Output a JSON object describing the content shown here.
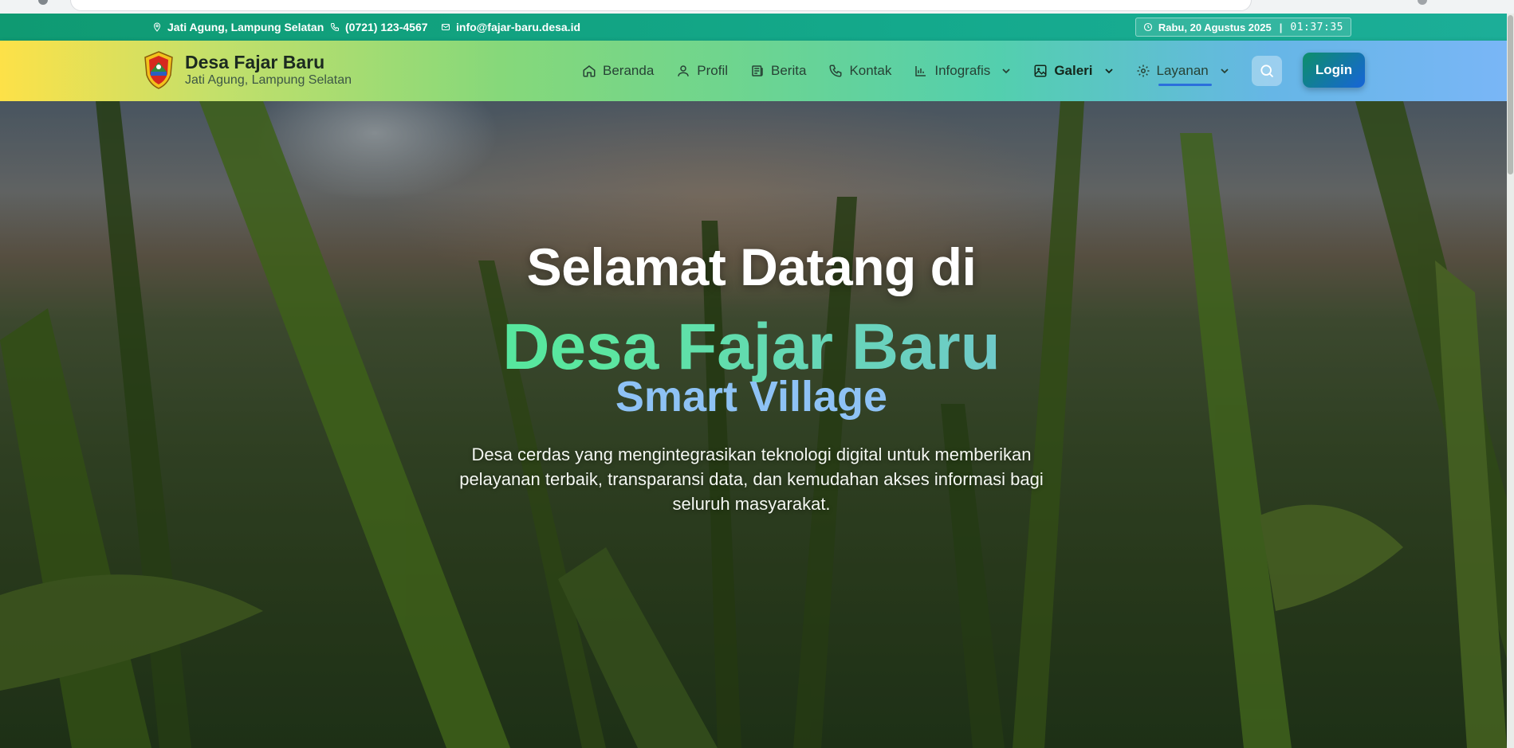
{
  "topbar": {
    "location": "Jati Agung, Lampung Selatan",
    "phone": "(0721) 123-4567",
    "email": "info@fajar-baru.desa.id",
    "date": "Rabu, 20 Agustus 2025",
    "time": "01:37:35"
  },
  "brand": {
    "title": "Desa Fajar Baru",
    "subtitle": "Jati Agung, Lampung Selatan"
  },
  "nav": {
    "items": [
      {
        "label": "Beranda",
        "icon": "home-icon"
      },
      {
        "label": "Profil",
        "icon": "user-icon"
      },
      {
        "label": "Berita",
        "icon": "newspaper-icon"
      },
      {
        "label": "Kontak",
        "icon": "phone-icon"
      },
      {
        "label": "Infografis",
        "icon": "bar-chart-icon",
        "dropdown": true
      },
      {
        "label": "Galeri",
        "icon": "image-icon",
        "dropdown": true
      },
      {
        "label": "Layanan",
        "icon": "gear-icon",
        "dropdown": true,
        "active": true
      }
    ],
    "login_label": "Login"
  },
  "hero": {
    "line1": "Selamat Datang di",
    "line2": "Desa Fajar Baru",
    "line3": "Smart Village",
    "description": "Desa cerdas yang mengintegrasikan teknologi digital untuk memberikan pelayanan terbaik, transparansi data, dan kemudahan akses informasi bagi seluruh masyarakat."
  },
  "colors": {
    "topbar": "#0f9a72",
    "accent_blue": "#2b6fdc",
    "hero_green": "#3ee38f",
    "hero_blue": "#8ec2f5"
  }
}
